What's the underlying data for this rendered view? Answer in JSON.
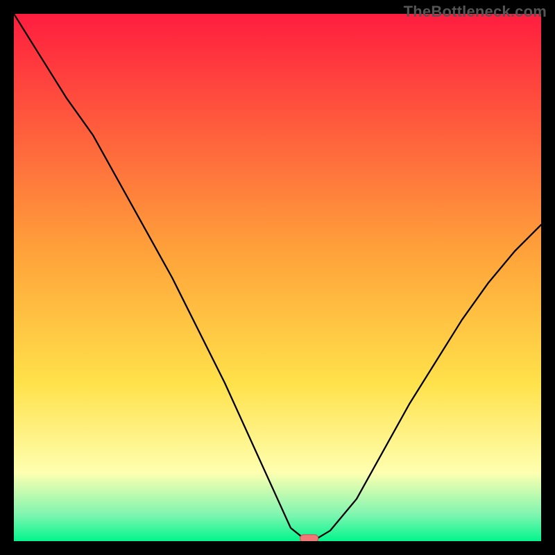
{
  "watermark": "TheBottleneck.com",
  "colors": {
    "frame": "#000000",
    "watermark": "#555555",
    "curve": "#000000",
    "marker_fill": "#f07878",
    "marker_stroke": "#d64a4a",
    "gradient": {
      "top": "#ff1d3f",
      "mid_orange": "#ffa23a",
      "mid_yellow": "#ffe14a",
      "pale_yellow": "#ffffb0",
      "mint": "#7ef5b0",
      "green": "#02f58d"
    }
  },
  "chart_data": {
    "type": "line",
    "title": "",
    "xlabel": "",
    "ylabel": "",
    "xlim": [
      0,
      100
    ],
    "ylim": [
      0,
      100
    ],
    "series": [
      {
        "name": "bottleneck-curve",
        "x": [
          0,
          5,
          10,
          15,
          20,
          25,
          30,
          35,
          40,
          45,
          50,
          52.5,
          55,
          57.5,
          60,
          65,
          70,
          75,
          80,
          85,
          90,
          95,
          100
        ],
        "y": [
          100,
          92,
          84,
          77,
          68,
          59,
          50,
          40,
          30,
          19,
          8,
          2.5,
          0.5,
          0.5,
          2,
          8,
          17,
          26,
          34,
          42,
          49,
          55,
          60
        ]
      }
    ],
    "marker": {
      "x": 56,
      "y": 0.5,
      "shape": "rounded-rect"
    },
    "gradient_stops": [
      {
        "pos": 0.0,
        "color": "#ff1d3f"
      },
      {
        "pos": 0.45,
        "color": "#ffa23a"
      },
      {
        "pos": 0.7,
        "color": "#ffe14a"
      },
      {
        "pos": 0.87,
        "color": "#ffffb0"
      },
      {
        "pos": 0.95,
        "color": "#7ef5b0"
      },
      {
        "pos": 1.0,
        "color": "#02f58d"
      }
    ]
  }
}
